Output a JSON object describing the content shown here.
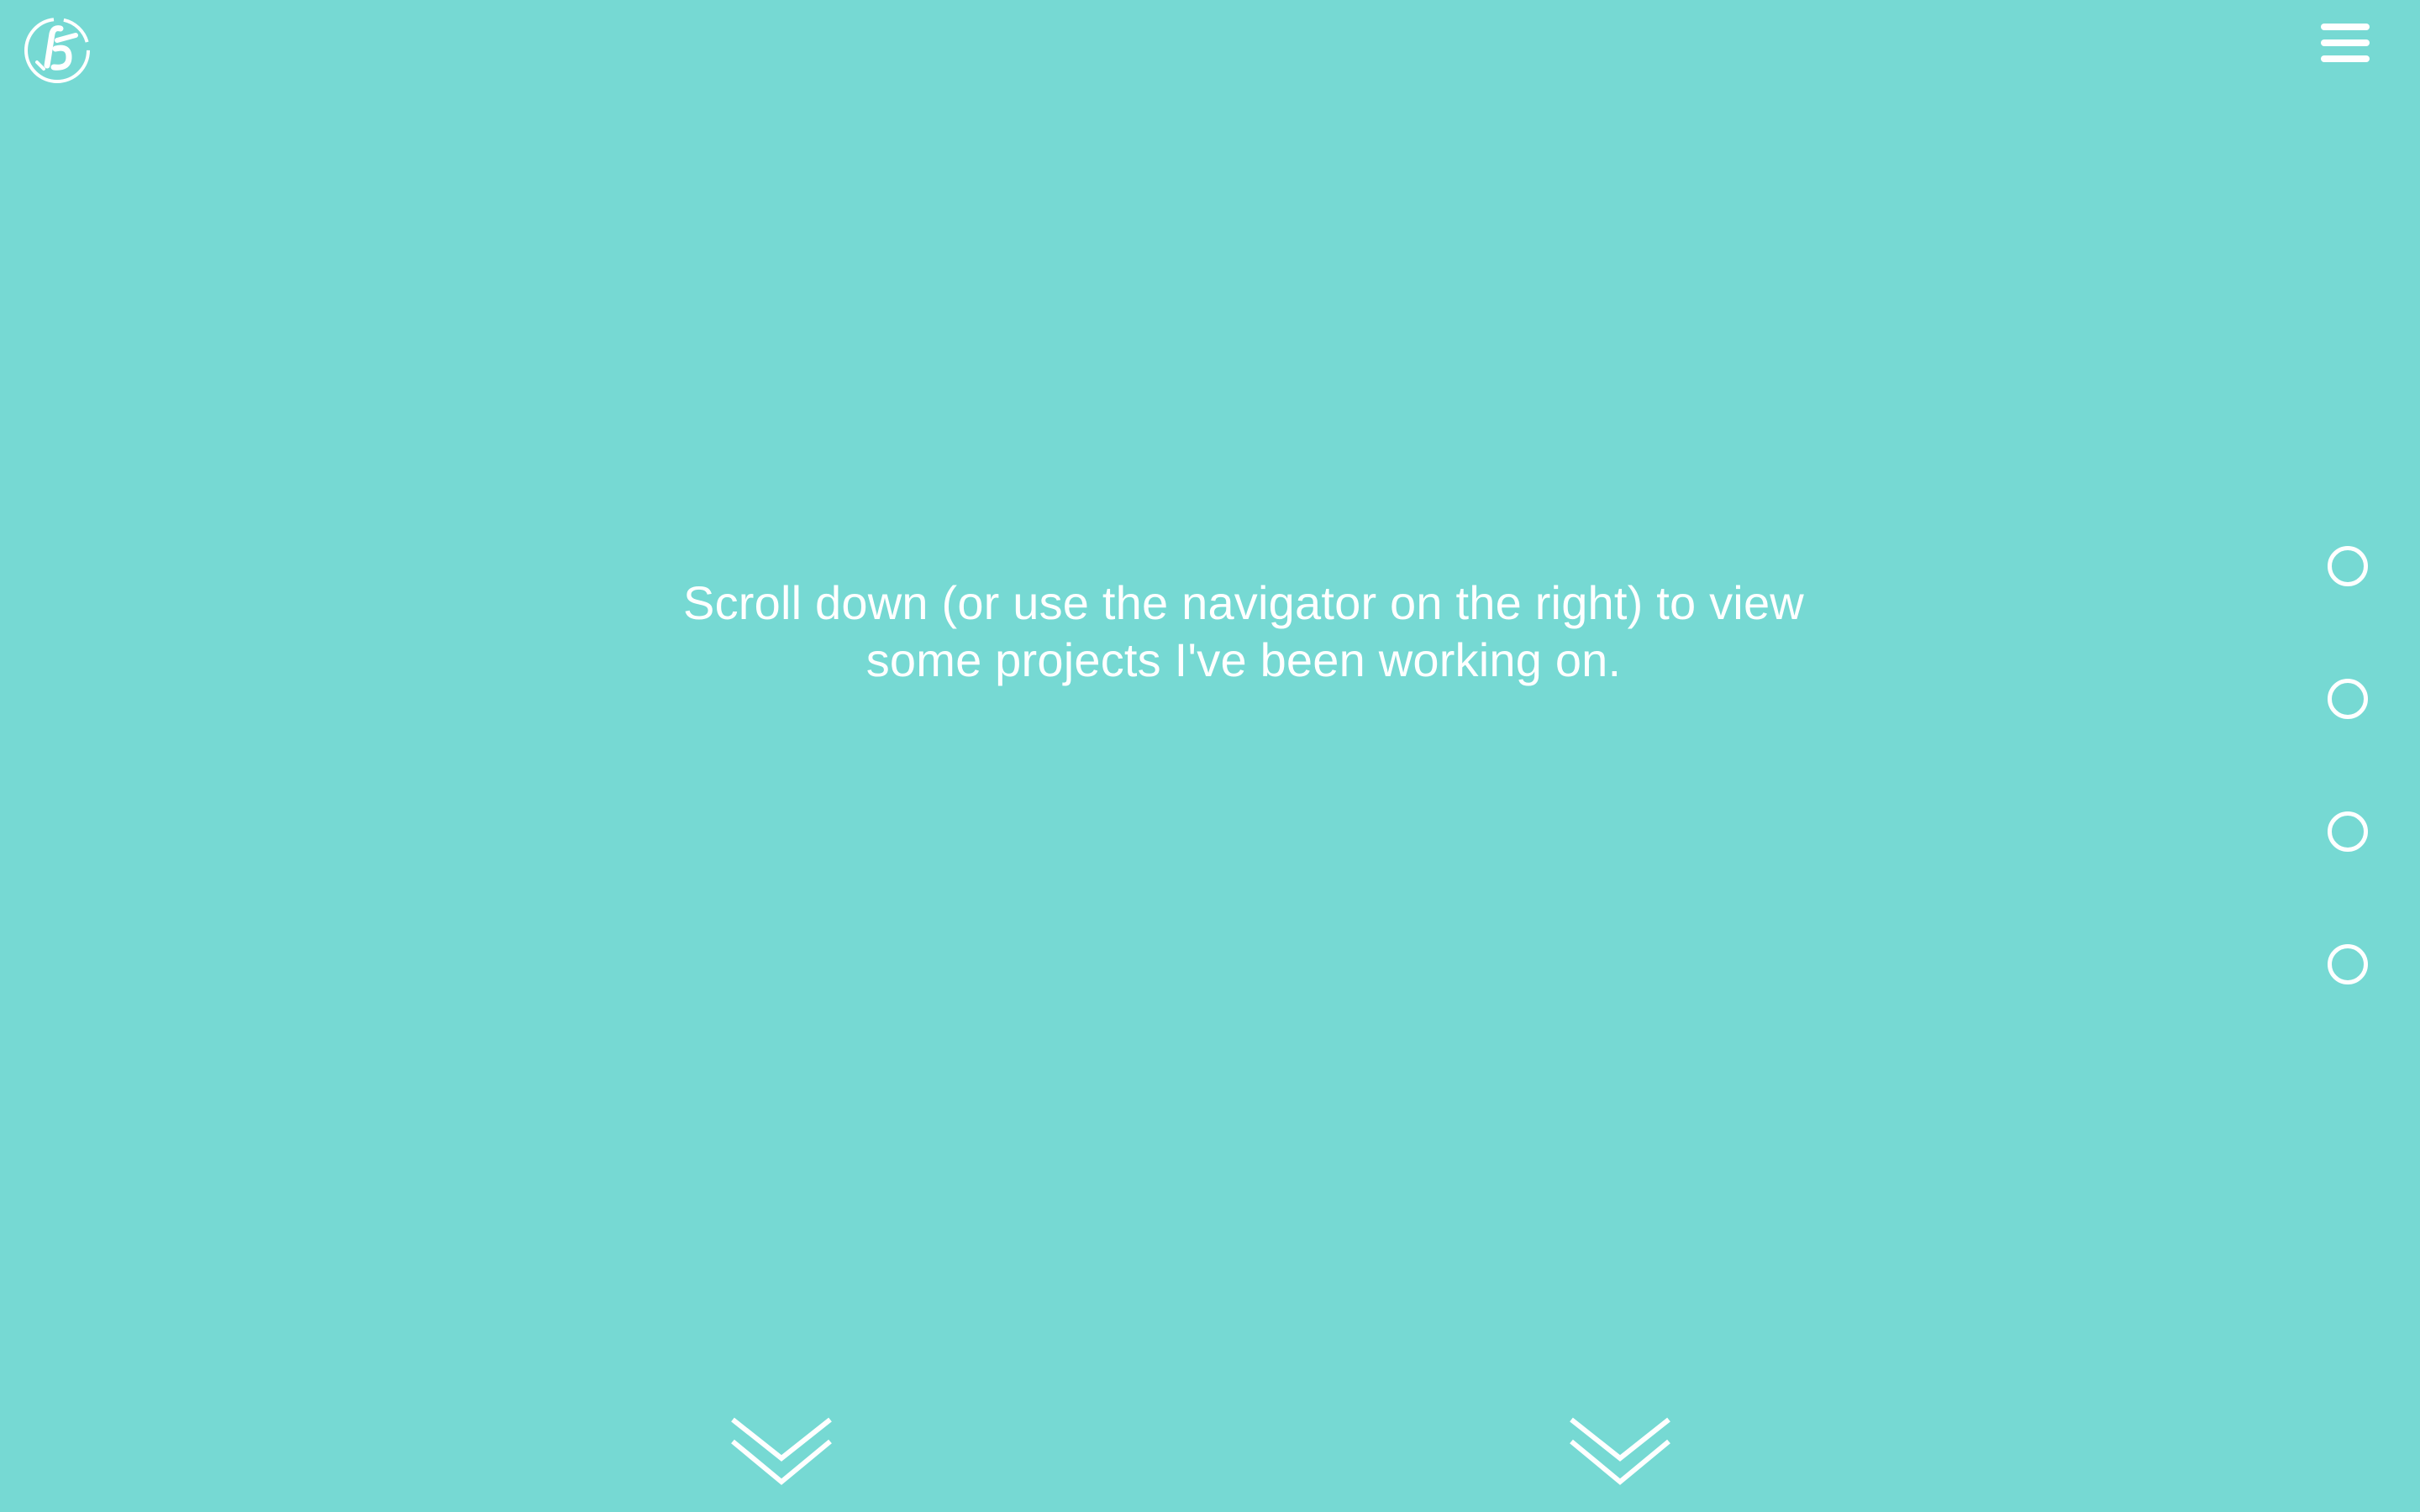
{
  "theme": {
    "background": "#76D9D3",
    "foreground": "#FFFFFF"
  },
  "header": {
    "logo_icon": "monogram-logo-icon",
    "menu_icon": "hamburger-menu-icon"
  },
  "hero": {
    "line1": "Scroll down (or use the navigator on the right) to view",
    "line2": "some projects I've been working on."
  },
  "navigator": {
    "dots": [
      {
        "icon": "circle-outline-icon"
      },
      {
        "icon": "circle-outline-icon"
      },
      {
        "icon": "circle-outline-icon"
      },
      {
        "icon": "circle-outline-icon"
      }
    ]
  },
  "scroll_arrows": [
    {
      "icon": "double-chevron-down-icon"
    },
    {
      "icon": "double-chevron-down-icon"
    }
  ]
}
